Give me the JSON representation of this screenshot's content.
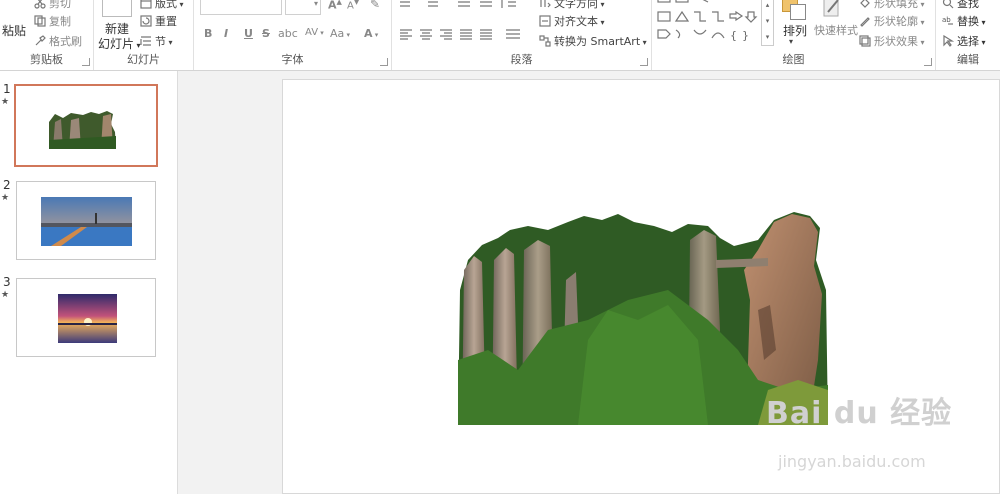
{
  "ribbon": {
    "clipboard": {
      "label": "剪贴板",
      "paste": "粘贴",
      "cut": "剪切",
      "copy": "复制",
      "format_painter": "格式刷"
    },
    "slides": {
      "label": "幻灯片",
      "new_slide_line1": "新建",
      "new_slide_line2": "幻灯片",
      "layout": "版式",
      "reset": "重置",
      "section": "节"
    },
    "font": {
      "label": "字体",
      "bold": "B",
      "italic": "I",
      "underline": "U",
      "strike": "S",
      "charspace": "AV",
      "case": "Aa",
      "color": "A"
    },
    "paragraph": {
      "label": "段落",
      "text_direction": "文字方向",
      "align_text": "对齐文本",
      "convert_smartart": "转换为 SmartArt"
    },
    "drawing": {
      "label": "绘图",
      "arrange": "排列",
      "quick_styles": "快速样式",
      "shape_fill": "形状填充",
      "shape_outline": "形状轮廓",
      "shape_effects": "形状效果"
    },
    "editing": {
      "label": "编辑",
      "find": "查找",
      "replace": "替换",
      "select": "选择"
    }
  },
  "thumbnails": [
    {
      "number": "1",
      "star": "★",
      "selected": true,
      "image": "cliff-rock-formation"
    },
    {
      "number": "2",
      "star": "★",
      "selected": false,
      "image": "city-harbor-sunset"
    },
    {
      "number": "3",
      "star": "★",
      "selected": false,
      "image": "sunset-over-water"
    }
  ],
  "slide": {
    "image": "cliff-rock-formation"
  },
  "watermark": {
    "brand": "Bai du 经验",
    "url": "jingyan.baidu.com"
  },
  "colors": {
    "selection_border": "#d1775a",
    "ribbon_bg": "#ffffff",
    "editor_bg": "#f2f2f2"
  }
}
